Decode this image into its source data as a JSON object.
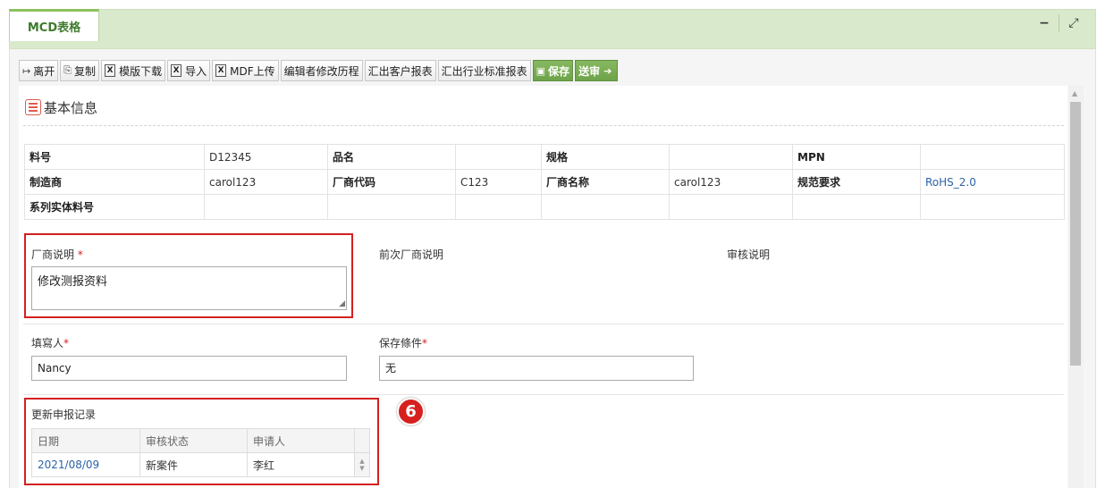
{
  "tab": {
    "label": "MCD表格"
  },
  "window_controls": {
    "minimize": "−",
    "expand": "⤢"
  },
  "toolbar": [
    {
      "icon": "exit-icon",
      "glyph": "↦",
      "label": "离开"
    },
    {
      "icon": "copy-icon",
      "glyph": "⎘",
      "label": "复制"
    },
    {
      "icon": "excel-icon",
      "glyph": "X",
      "label": "模版下载"
    },
    {
      "icon": "excel-icon",
      "glyph": "X",
      "label": "导入"
    },
    {
      "icon": "excel-icon",
      "glyph": "X",
      "label": "MDF上传"
    },
    {
      "label": "编辑者修改历程"
    },
    {
      "label": "汇出客户报表"
    },
    {
      "label": "汇出行业标准报表"
    },
    {
      "icon": "save-icon",
      "glyph": "▣",
      "label": "保存"
    },
    {
      "icon": "arrow-right-icon",
      "glyph": "➔",
      "label": "送审"
    }
  ],
  "section": {
    "title": "基本信息"
  },
  "info_table": {
    "rows": [
      [
        "料号",
        "D12345",
        "品名",
        "",
        "规格",
        "",
        "MPN",
        ""
      ],
      [
        "制造商",
        "carol123",
        "厂商代码",
        "C123",
        "厂商名称",
        "carol123",
        "规范要求",
        "RoHS_2.0"
      ],
      [
        "系列实体料号",
        "",
        "",
        "",
        "",
        "",
        "",
        ""
      ]
    ]
  },
  "vendor_note": {
    "label": "厂商说明",
    "required_mark": "*",
    "value": "修改测报资料"
  },
  "prev_vendor_note": {
    "label": "前次厂商说明"
  },
  "review_note": {
    "label": "审核说明"
  },
  "filler": {
    "label": "填寫人",
    "required_mark": "*",
    "value": "Nancy"
  },
  "storage": {
    "label": "保存條件",
    "required_mark": "*",
    "value": "无"
  },
  "records": {
    "title": "更新申报记录",
    "columns": [
      "日期",
      "审核状态",
      "申请人"
    ],
    "rows": [
      [
        "2021/08/09",
        "新案件",
        "李红"
      ]
    ]
  },
  "step_badge": "6"
}
